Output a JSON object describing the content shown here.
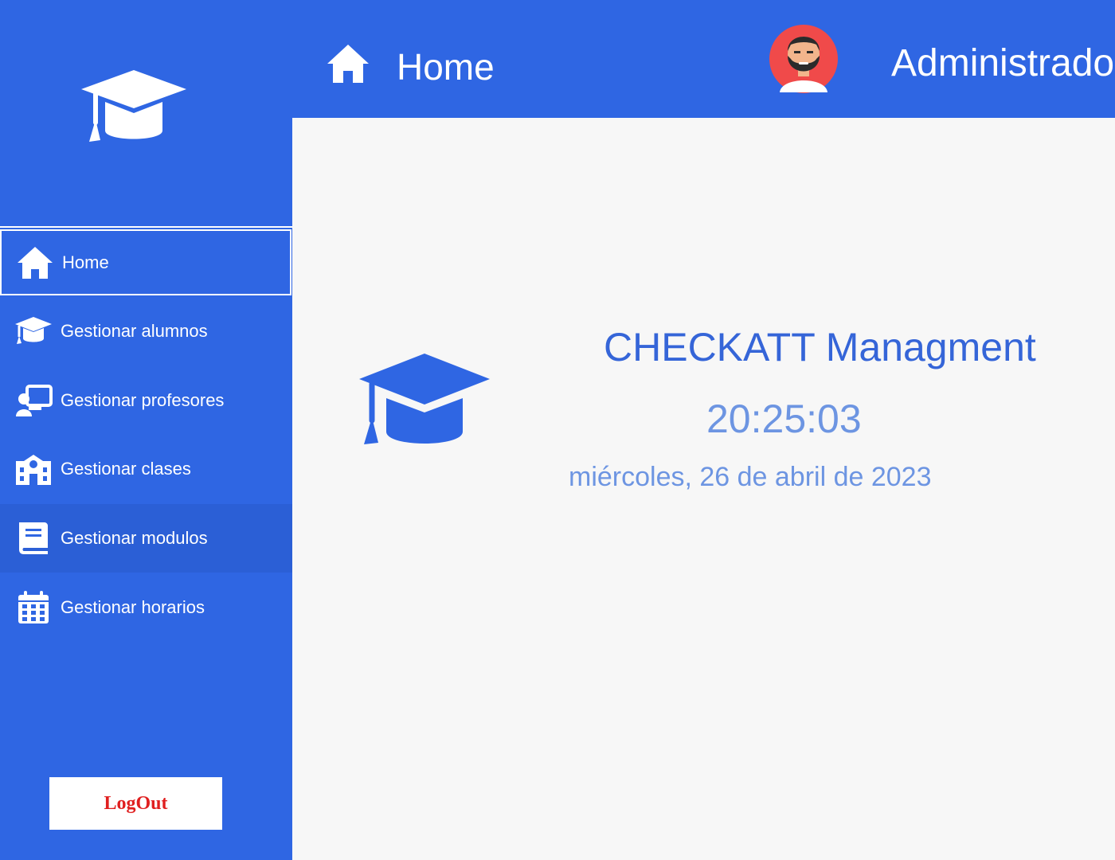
{
  "colors": {
    "primary": "#2f66e3",
    "background": "#f7f7f7",
    "title_text": "#3565d8",
    "muted_text": "#6d95e2",
    "logout_text": "#e01f1f",
    "avatar_bg": "#f04a4a"
  },
  "header": {
    "title": "Home",
    "title_icon": "home-icon",
    "user_avatar_icon": "bearded-man-avatar",
    "user_name": "Administrador"
  },
  "sidebar": {
    "logo_icon": "graduation-cap-icon",
    "items": [
      {
        "label": "Home",
        "icon": "home-icon",
        "state": "active"
      },
      {
        "label": "Gestionar alumnos",
        "icon": "graduation-cap-icon",
        "state": "normal"
      },
      {
        "label": "Gestionar profesores",
        "icon": "teacher-board-icon",
        "state": "normal"
      },
      {
        "label": "Gestionar clases",
        "icon": "school-building-icon",
        "state": "normal"
      },
      {
        "label": "Gestionar modulos",
        "icon": "book-icon",
        "state": "hover"
      },
      {
        "label": "Gestionar horarios",
        "icon": "calendar-icon",
        "state": "normal"
      }
    ],
    "logout_label": "LogOut"
  },
  "main": {
    "logo_icon": "graduation-cap-icon",
    "app_title": "CHECKATT Managment",
    "clock": "20:25:03",
    "date": "miércoles, 26 de abril de 2023"
  }
}
